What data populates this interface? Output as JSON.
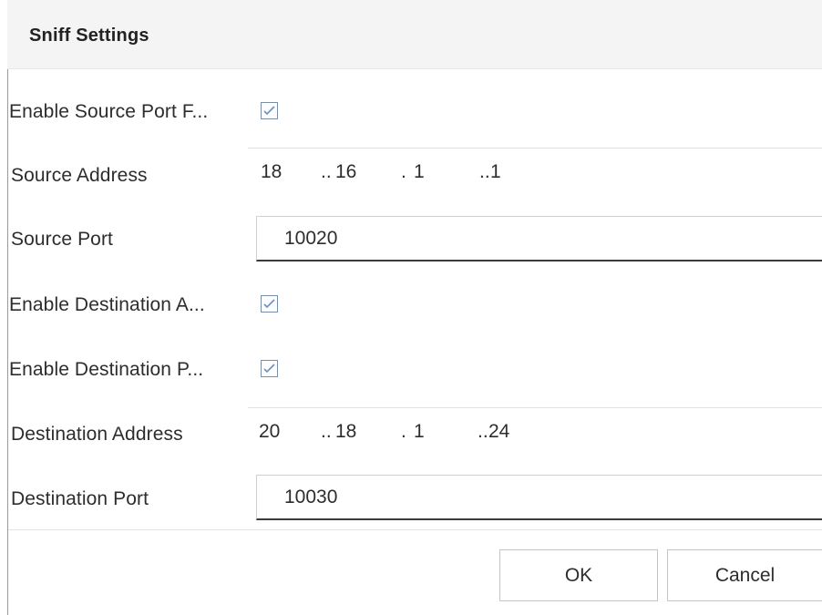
{
  "dialog": {
    "title": "Sniff Settings"
  },
  "form": {
    "enable_source_port": {
      "label": "Enable Source Port F...",
      "checked": true
    },
    "source_address": {
      "label": "Source Address",
      "octets": [
        "18",
        "16",
        "1",
        "1"
      ]
    },
    "source_port": {
      "label": "Source Port",
      "value": "10020"
    },
    "enable_destination_address": {
      "label": "Enable Destination A...",
      "checked": true
    },
    "enable_destination_port": {
      "label": "Enable Destination P...",
      "checked": true
    },
    "destination_address": {
      "label": "Destination Address",
      "octets": [
        "20",
        "18",
        "1",
        "24"
      ]
    },
    "destination_port": {
      "label": "Destination Port",
      "value": "10030"
    }
  },
  "buttons": {
    "ok": "OK",
    "cancel": "Cancel"
  },
  "colors": {
    "title_bar_bg": "#f4f4f4",
    "checkbox_check": "#6f8fbf",
    "text": "#2d2d2d"
  }
}
